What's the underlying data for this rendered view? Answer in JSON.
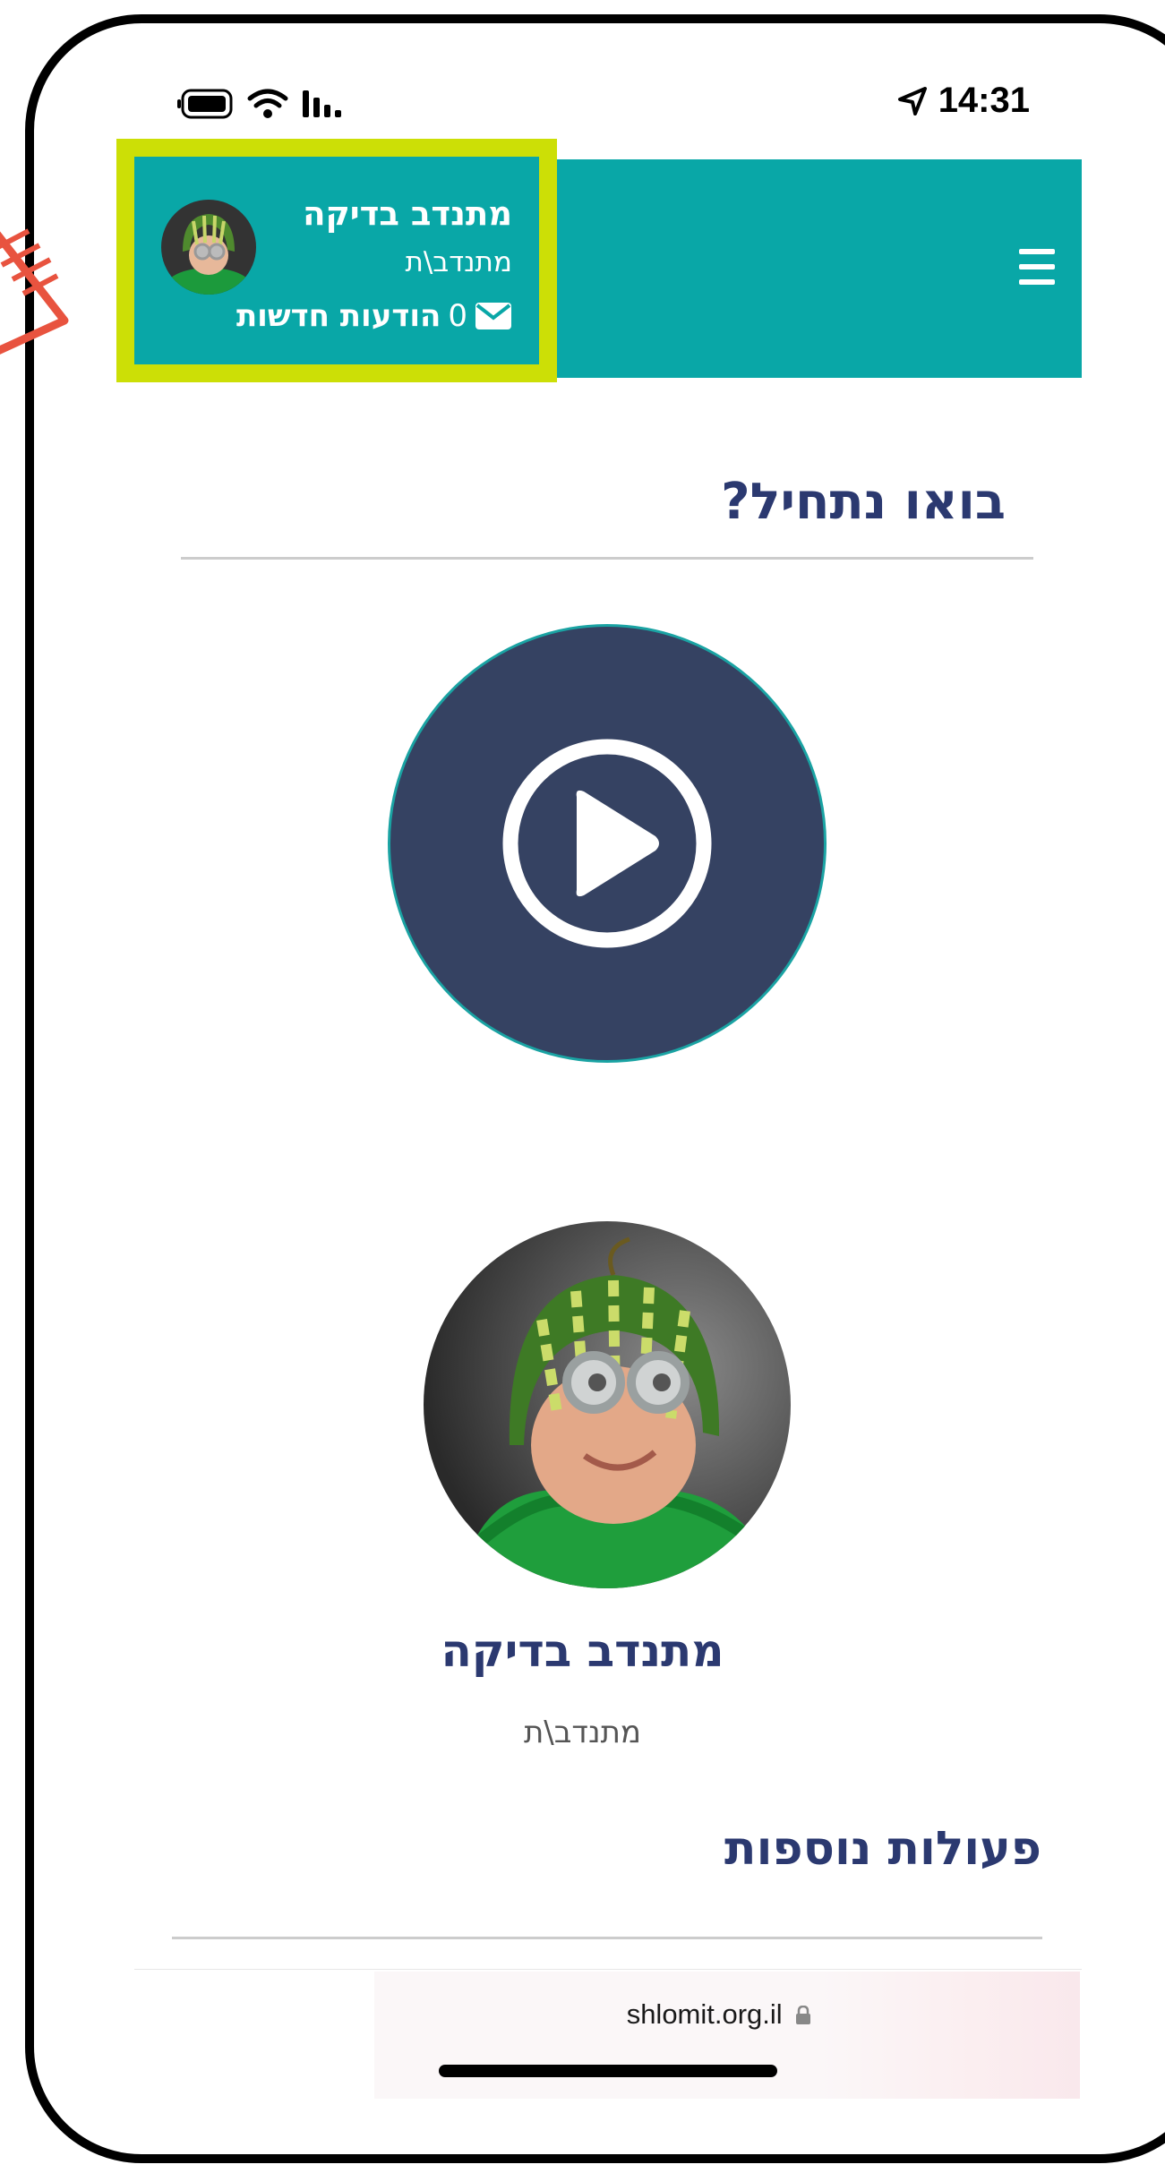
{
  "status_bar": {
    "time": "14:31",
    "icons": [
      "location-arrow-icon",
      "battery-icon",
      "wifi-icon",
      "signal-icon"
    ]
  },
  "header": {
    "menu_icon": "hamburger-menu-icon",
    "user": {
      "name": "מתנדב בדיקה",
      "role": "מתנדב\\ת",
      "messages_count": "0",
      "messages_label": "הודעות חדשות",
      "messages_icon": "envelope-icon"
    }
  },
  "main": {
    "section_title": "בואו נתחיל?",
    "video_icon": "play-circle-icon",
    "profile": {
      "name": "מתנדב בדיקה",
      "role": "מתנדב\\ת"
    },
    "more_actions_title": "פעולות נוספות"
  },
  "browser": {
    "url": "shlomit.org.il",
    "lock_icon": "lock-icon"
  },
  "colors": {
    "header_teal": "#09a7a7",
    "highlight_box": "#ccdf06",
    "heading_navy": "#2b3970",
    "video_bg": "#354262",
    "annotation_red": "#e8533f"
  }
}
